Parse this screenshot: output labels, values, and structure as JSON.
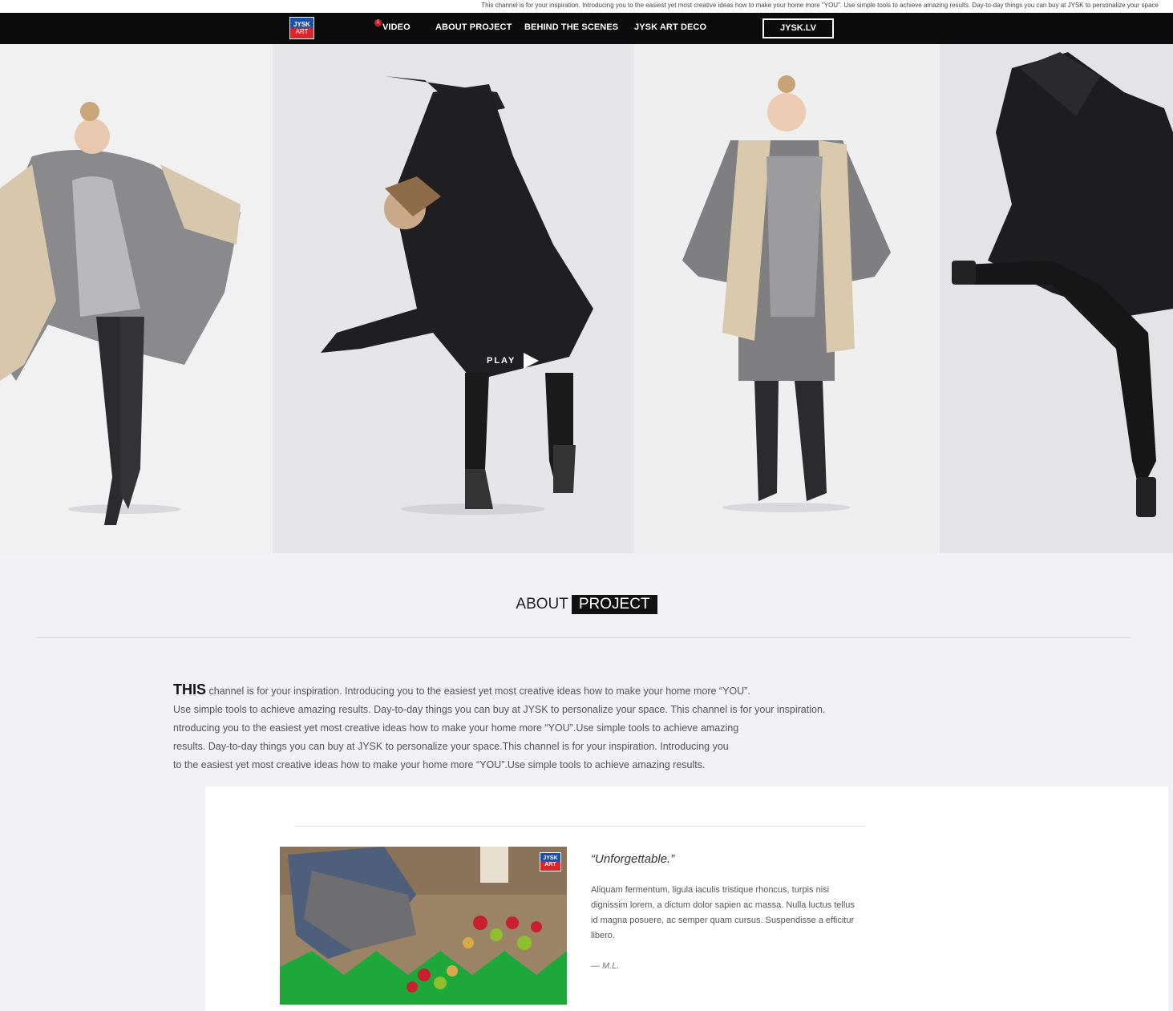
{
  "topline": {
    "text": "This channel is for your inspiration. Introducing you to the easiest yet most creative ideas how to make your home more \"YOU\". Use simple tools to achieve amazing results. Day-to-day things you can buy at JYSK to personalize your space"
  },
  "nav": {
    "logo_line1": "JYSK",
    "logo_line2": "ART",
    "badge": "1",
    "items": [
      "VIDEO",
      "ABOUT PROJECT",
      "BEHIND THE SCENES",
      "JYSK ART DECO"
    ],
    "button": "JYSK.LV"
  },
  "hero": {
    "play_label": "PLAY"
  },
  "about": {
    "word1": "ABOUT",
    "word2": "PROJECT"
  },
  "intro": {
    "lead": "THIS",
    "line1": " channel is for your inspiration. Introducing you to the easiest yet most creative ideas how to make your home more “YOU”.",
    "line2": "Use simple tools to achieve amazing results. Day-to-day things you can buy at JYSK to personalize your space. This channel is for your inspiration.",
    "line3": "ntroducing you to the easiest yet most creative ideas how to make your home more “YOU”.Use simple tools to achieve amazing",
    "line4": "results. Day-to-day things you can buy at JYSK to personalize your space.This channel is for your inspiration. Introducing you",
    "line5": "to the easiest yet most creative ideas how to make your home more “YOU”.Use simple tools to achieve amazing results."
  },
  "testimonial": {
    "logo_line1": "JYSK",
    "logo_line2": "ART",
    "title": "“Unforgettable.”",
    "body": "Aliquam fermentum, ligula iaculis tristique rhoncus, turpis nisi dignissim lorem, a dictum dolor sapien ac massa. Nulla luctus tellus id magna posuere, ac semper quam cursus. Suspendisse a efficitur libero.",
    "author": "— M.L."
  }
}
